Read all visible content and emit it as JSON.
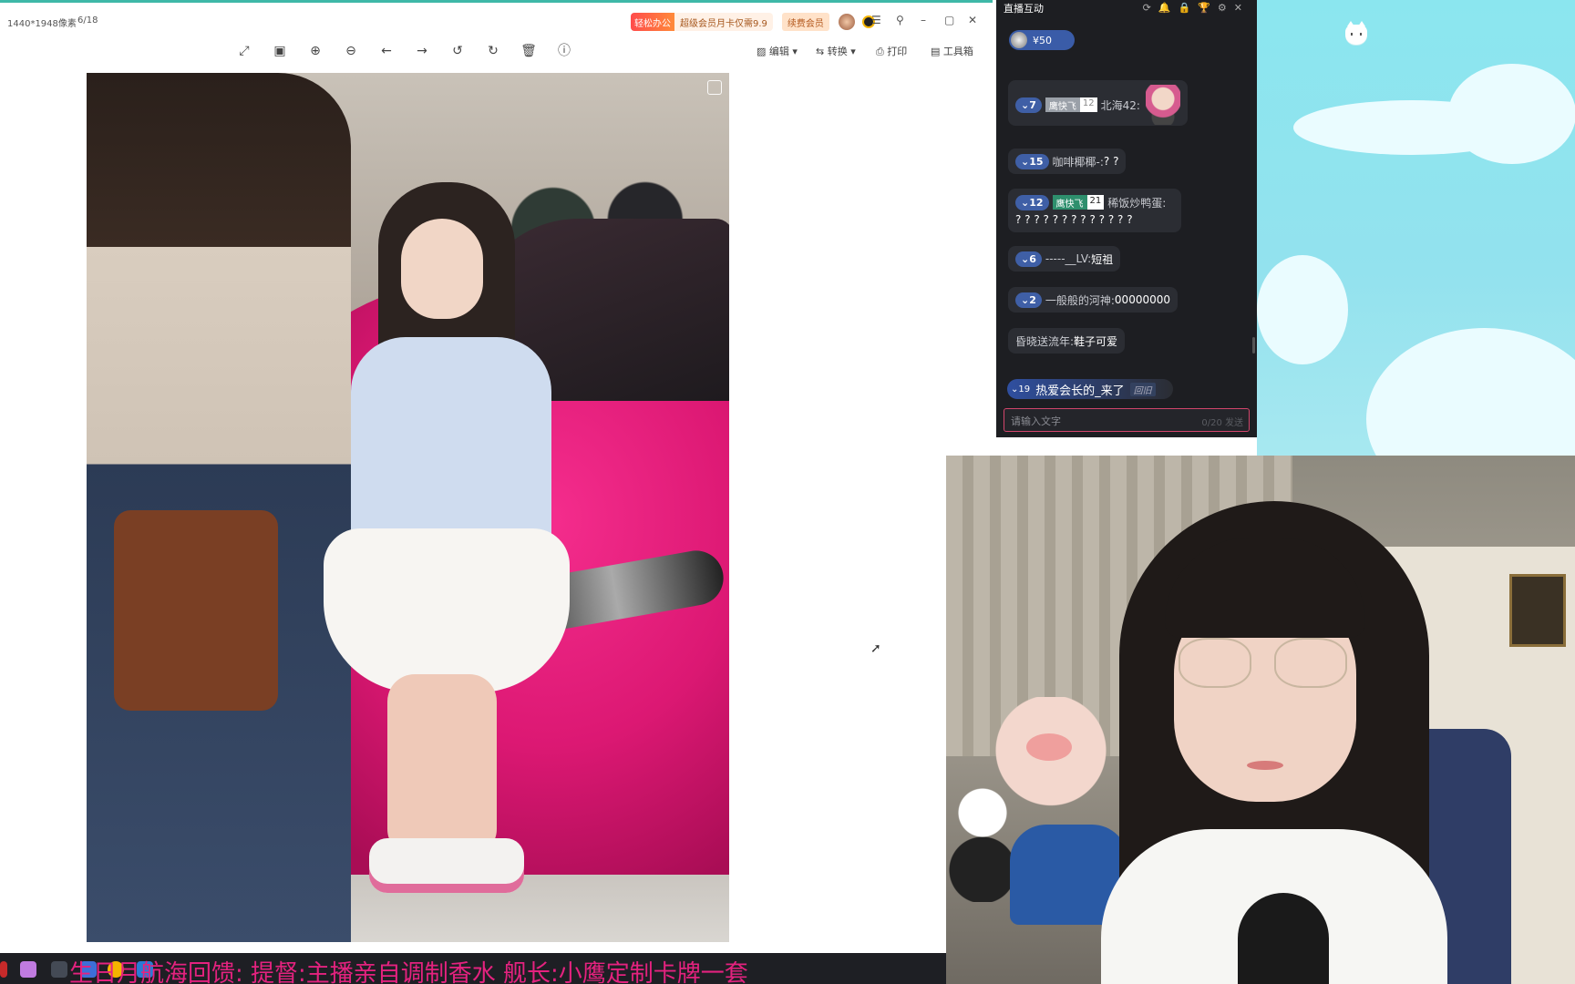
{
  "viewer": {
    "image_info": "1440*1948像素",
    "page_counter": "6/18",
    "promo_badge": "轻松办公",
    "promo_text": "超级会员月卡仅需9.9",
    "renew_label": "续费会员",
    "menu_icon": "menu-icon",
    "toolbar": {
      "edit_label": "编辑",
      "convert_label": "转换",
      "print_label": "打印",
      "toolbox_label": "工具箱"
    }
  },
  "chat": {
    "title": "直播互动",
    "gift_amount": "¥50",
    "messages": [
      {
        "level": "7",
        "medal_name": "鹰快飞",
        "medal_level": "12",
        "user": "北海42:",
        "text": ""
      },
      {
        "level": "15",
        "user": "咖啡椰椰-:",
        "text": "? ?"
      },
      {
        "level": "12",
        "medal_name": "鹰快飞",
        "medal_level": "21",
        "user": "稀饭炒鸭蛋:",
        "text": "? ? ? ? ? ? ? ? ? ? ? ? ?"
      },
      {
        "level": "6",
        "user": "-----__LV:",
        "text": "短祖"
      },
      {
        "level": "2",
        "user": "一般般的河神:",
        "text": "00000000"
      },
      {
        "user": "昏晓送流年:",
        "text": "鞋子可爱"
      }
    ],
    "enter": {
      "level": "19",
      "text": "热爱会长的_来了",
      "reply": "回旧"
    },
    "input_placeholder": "请输入文字",
    "input_count": "0/20",
    "send_label": "发送"
  },
  "marquee_text": "生日月航海回馈:  提督:主播亲自调制香水  舰长:小鹰定制卡牌一套",
  "colors": {
    "accent_pink": "#e4227f",
    "chat_bg": "#1d1e22",
    "level_blue": "#3f5fa6",
    "sky": "#8be6ef"
  }
}
